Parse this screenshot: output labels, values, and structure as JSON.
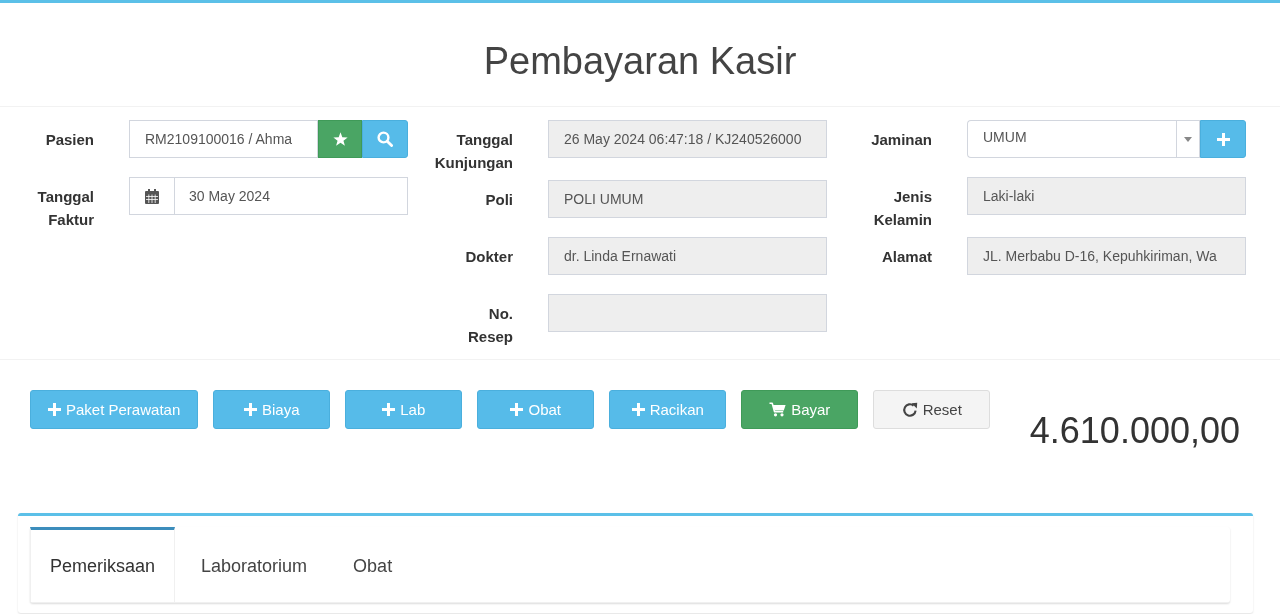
{
  "header": {
    "title": "Pembayaran Kasir"
  },
  "form": {
    "columns": [
      {
        "fields": [
          {
            "label": "Pasien",
            "kind": "search",
            "value": "RM2109100016 / Ahma"
          },
          {
            "label": "Tanggal Faktur",
            "kind": "date",
            "value": "30 May 2024"
          }
        ]
      },
      {
        "fields": [
          {
            "label": "Tanggal Kunjungan",
            "kind": "readonly",
            "value": "26 May 2024 06:47:18 / KJ240526000"
          },
          {
            "label": "Poli",
            "kind": "readonly",
            "value": "POLI UMUM"
          },
          {
            "label": "Dokter",
            "kind": "readonly",
            "value": "dr. Linda Ernawati"
          },
          {
            "label": "No. Resep",
            "kind": "readonly"
          }
        ]
      },
      {
        "fields": [
          {
            "label": "Jaminan",
            "kind": "select",
            "value": "UMUM"
          },
          {
            "label": "Jenis Kelamin",
            "kind": "readonly",
            "value": "Laki-laki"
          },
          {
            "label": "Alamat",
            "kind": "readonly",
            "value": "JL. Merbabu D-16, Kepuhkiriman, Wa"
          }
        ]
      }
    ]
  },
  "actions": [
    {
      "label": "Paket Perawatan",
      "kind": "add"
    },
    {
      "label": "Biaya",
      "kind": "add"
    },
    {
      "label": "Lab",
      "kind": "add"
    },
    {
      "label": "Obat",
      "kind": "add"
    },
    {
      "label": "Racikan",
      "kind": "add"
    },
    {
      "label": "Bayar",
      "kind": "pay"
    },
    {
      "label": "Reset",
      "kind": "reset"
    }
  ],
  "total": "4.610.000,00",
  "tabs": [
    {
      "label": "Pemeriksaan",
      "selected": true
    },
    {
      "label": "Laboratorium",
      "selected": false
    },
    {
      "label": "Obat",
      "selected": false
    }
  ]
}
